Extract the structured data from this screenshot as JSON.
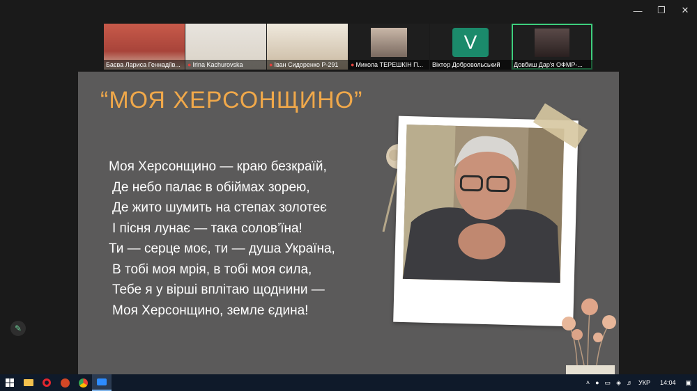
{
  "participants": [
    {
      "name": "Баєва Лариса Геннадіїв...",
      "muted": false,
      "active": false
    },
    {
      "name": "Irina Kachurovska",
      "muted": true,
      "active": false
    },
    {
      "name": "Іван Сидоренко Р-291",
      "muted": true,
      "active": false
    },
    {
      "name": "Микола ТЕРЕШКІН П...",
      "muted": true,
      "active": false
    },
    {
      "name": "Віктор Добровольський",
      "muted": false,
      "active": false,
      "avatar_letter": "V"
    },
    {
      "name": "Довбиш Дар'я  ОФМР-...",
      "muted": false,
      "active": true
    }
  ],
  "slide": {
    "title": "“МОЯ ХЕРСОНЩИНО”",
    "poem": [
      "Моя Херсонщино — краю безкраїй,",
      "Де небо палає в обіймах зорею,",
      "Де жито шумить на степах золотеє",
      "І пісня лунає — така солов’їна!",
      "Ти — серце моє, ти — душа Україна,",
      "В тобі моя мрія, в тобі моя сила,",
      "Тебе я у вірші вплітаю щоднини —",
      "Моя Херсонщино, земле єдина!"
    ]
  },
  "tray": {
    "language": "УКР",
    "time": "14:04"
  },
  "colors": {
    "title": "#f0a84a",
    "slide_bg": "#5b5a5a",
    "active_tile_border": "#3ecf7d"
  }
}
